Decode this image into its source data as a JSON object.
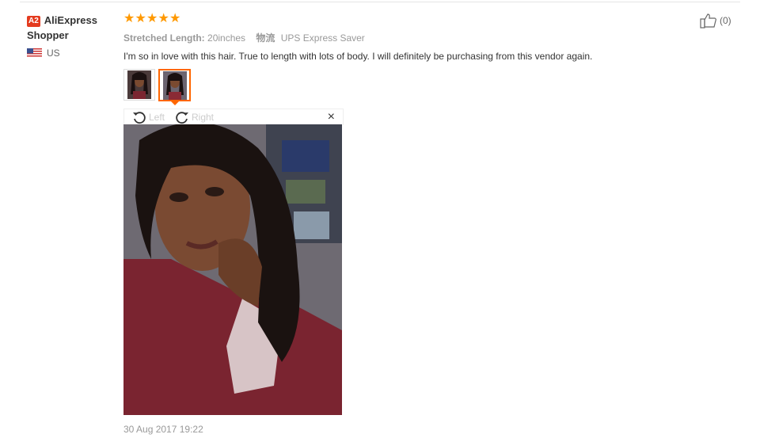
{
  "user": {
    "level_badge": "A2",
    "name": "AliExpress Shopper",
    "country": "US"
  },
  "review": {
    "rating": 5,
    "stars": [
      "★",
      "★",
      "★",
      "★",
      "★"
    ],
    "attributes": {
      "length_label": "Stretched Length:",
      "length_value": "20inches",
      "shipping_label": "物流",
      "shipping_value": "UPS Express Saver"
    },
    "text": "I'm so in love with this hair. True to length with lots of body. I will definitely be purchasing from this vendor again.",
    "date": "30 Aug 2017 19:22",
    "like_count": "(0)"
  },
  "viewer": {
    "rotate_left_label": "Left",
    "rotate_right_label": "Right",
    "close_label": "×"
  },
  "colors": {
    "star": "#ff9900",
    "badge": "#e43b1f",
    "selected_thumb": "#ff6600"
  }
}
